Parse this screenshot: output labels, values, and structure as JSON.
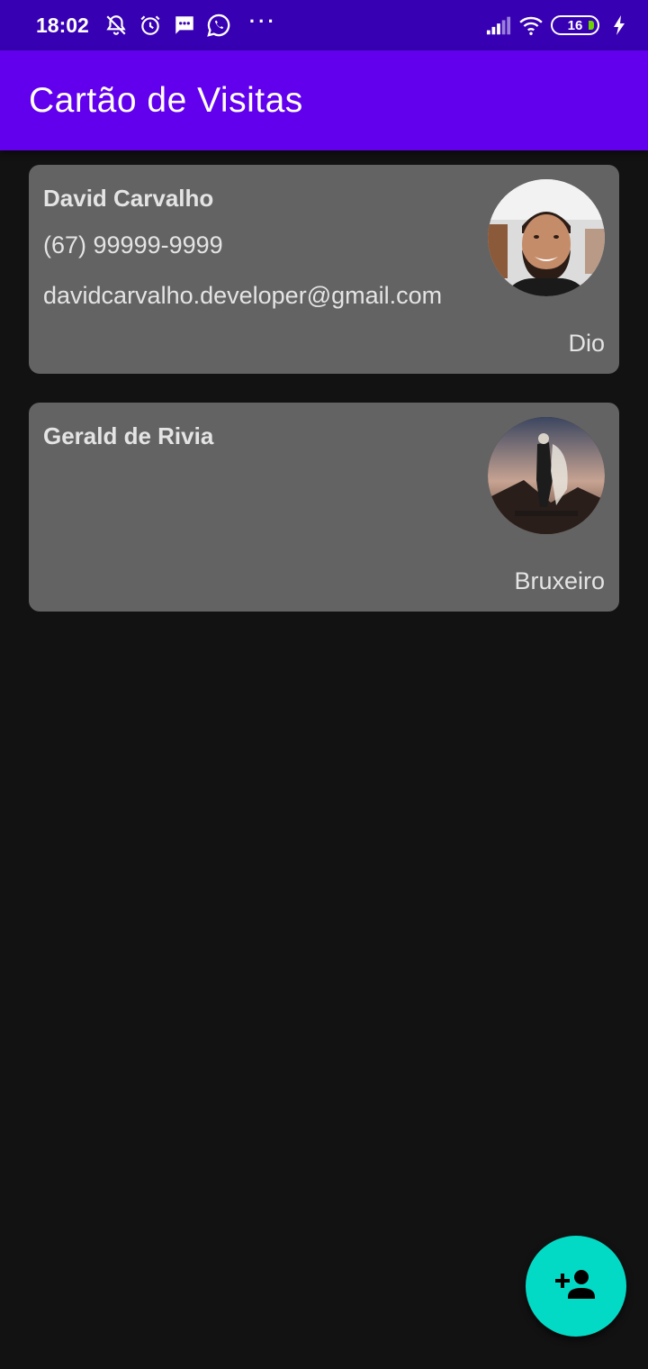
{
  "status_bar": {
    "time": "18:02",
    "battery_level": "16",
    "icons": [
      "notifications-off-icon",
      "alarm-icon",
      "message-icon",
      "whatsapp-icon",
      "more-dots-icon",
      "signal-icon",
      "wifi-icon",
      "battery-icon",
      "charging-icon"
    ]
  },
  "app_bar": {
    "title": "Cartão de Visitas"
  },
  "cards": [
    {
      "name": "David Carvalho",
      "phone": "(67) 99999-9999",
      "email": "davidcarvalho.developer@gmail.com",
      "company": "Dio",
      "avatar": "person-photo"
    },
    {
      "name": "Gerald de Rivia",
      "phone": "",
      "email": "",
      "company": "Bruxeiro",
      "avatar": "the-witcher-poster"
    }
  ],
  "fab": {
    "icon": "add-person-icon"
  },
  "colors": {
    "status_bar": "#3700b3",
    "app_bar": "#6200ee",
    "background": "#121212",
    "card": "#636363",
    "fab": "#03dac5"
  }
}
